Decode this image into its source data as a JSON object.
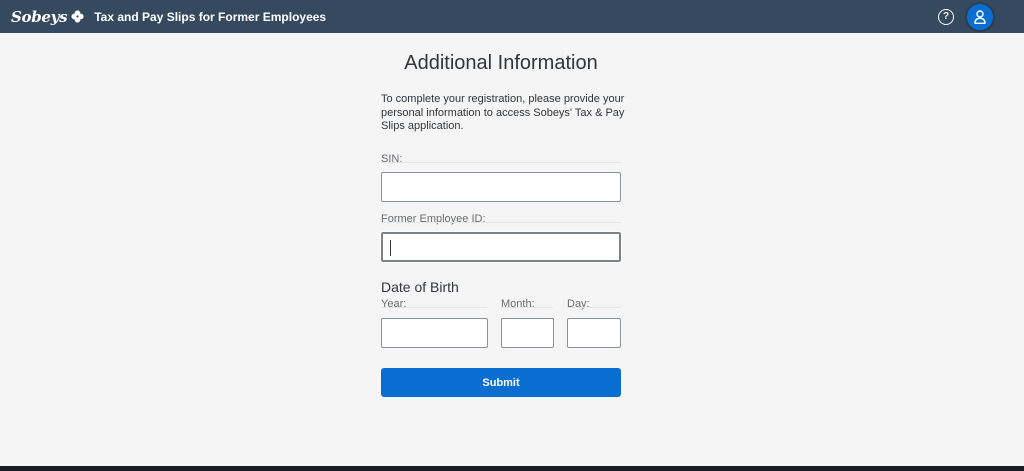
{
  "header": {
    "logo_text": "Sobeys",
    "title": "Tax and Pay Slips for Former Employees",
    "help_icon": "help-circle-icon",
    "user_icon": "user-avatar-icon"
  },
  "form": {
    "title": "Additional Information",
    "intro": "To complete your registration, please provide your personal information to access Sobeys' Tax & Pay Slips application.",
    "sin_label": "SIN:",
    "sin_value": "",
    "employee_id_label": "Former Employee ID:",
    "employee_id_value": "",
    "dob_title": "Date of Birth",
    "year_label": "Year:",
    "year_value": "",
    "month_label": "Month:",
    "month_value": "",
    "day_label": "Day:",
    "day_value": "",
    "submit_label": "Submit"
  },
  "colors": {
    "shellbar": "#354a5f",
    "accent": "#0a6ed1",
    "background": "#f5f5f5"
  }
}
